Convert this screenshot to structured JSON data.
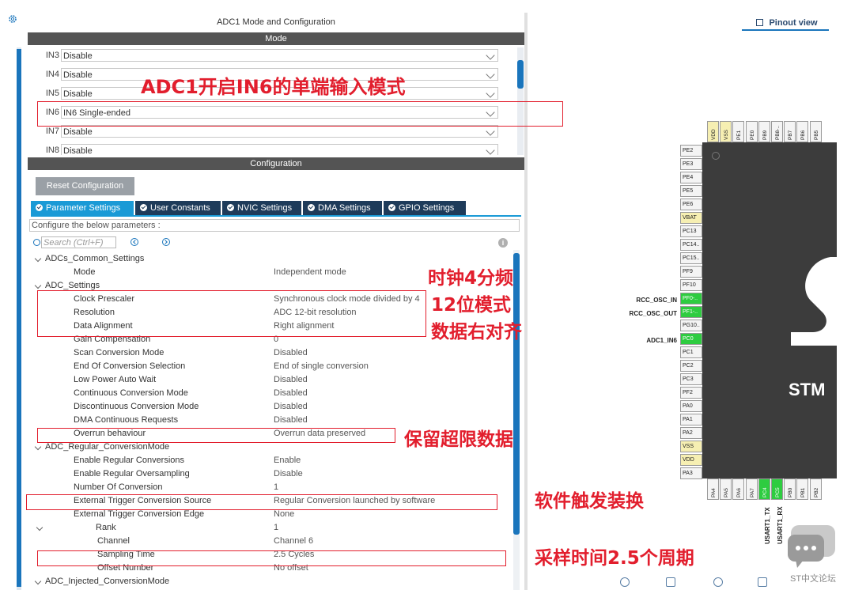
{
  "panel_title": "ADC1 Mode and Configuration",
  "mode_bar": "Mode",
  "config_bar": "Configuration",
  "inputs": [
    {
      "label": "IN3",
      "value": "Disable"
    },
    {
      "label": "IN4",
      "value": "Disable"
    },
    {
      "label": "IN5",
      "value": "Disable"
    },
    {
      "label": "IN6",
      "value": "IN6 Single-ended"
    },
    {
      "label": "IN7",
      "value": "Disable"
    },
    {
      "label": "IN8",
      "value": "Disable"
    }
  ],
  "reset_button": "Reset Configuration",
  "tabs": [
    "Parameter Settings",
    "User Constants",
    "NVIC Settings",
    "DMA Settings",
    "GPIO Settings"
  ],
  "config_desc": "Configure the below parameters :",
  "search_placeholder": "Search (Ctrl+F)",
  "info": "i",
  "params": [
    {
      "name": "ADCs_Common_Settings",
      "value": "",
      "level": 0,
      "group": true
    },
    {
      "name": "Mode",
      "value": "Independent mode",
      "level": 1
    },
    {
      "name": "ADC_Settings",
      "value": "",
      "level": 0,
      "group": true
    },
    {
      "name": "Clock Prescaler",
      "value": "Synchronous clock mode divided by 4",
      "level": 1
    },
    {
      "name": "Resolution",
      "value": "ADC 12-bit resolution",
      "level": 1
    },
    {
      "name": "Data Alignment",
      "value": "Right alignment",
      "level": 1
    },
    {
      "name": "Gain Compensation",
      "value": "0",
      "level": 1
    },
    {
      "name": "Scan Conversion Mode",
      "value": "Disabled",
      "level": 1
    },
    {
      "name": "End Of Conversion Selection",
      "value": "End of single conversion",
      "level": 1
    },
    {
      "name": "Low Power Auto Wait",
      "value": "Disabled",
      "level": 1
    },
    {
      "name": "Continuous Conversion Mode",
      "value": "Disabled",
      "level": 1
    },
    {
      "name": "Discontinuous Conversion Mode",
      "value": "Disabled",
      "level": 1
    },
    {
      "name": "DMA Continuous Requests",
      "value": "Disabled",
      "level": 1
    },
    {
      "name": "Overrun behaviour",
      "value": "Overrun data preserved",
      "level": 1
    },
    {
      "name": "ADC_Regular_ConversionMode",
      "value": "",
      "level": 0,
      "group": true
    },
    {
      "name": "Enable Regular Conversions",
      "value": "Enable",
      "level": 1
    },
    {
      "name": "Enable Regular Oversampling",
      "value": "Disable",
      "level": 1
    },
    {
      "name": "Number Of Conversion",
      "value": "1",
      "level": 1
    },
    {
      "name": "External Trigger Conversion Source",
      "value": "Regular Conversion launched by software",
      "level": 1
    },
    {
      "name": "External Trigger Conversion Edge",
      "value": "None",
      "level": 1
    },
    {
      "name": "Rank",
      "value": "1",
      "level": 2,
      "group": true
    },
    {
      "name": "Channel",
      "value": "Channel 6",
      "level": 3
    },
    {
      "name": "Sampling Time",
      "value": "2.5 Cycles",
      "level": 3
    },
    {
      "name": "Offset Number",
      "value": "No offset",
      "level": 3
    },
    {
      "name": "ADC_Injected_ConversionMode",
      "value": "",
      "level": 0,
      "group": true
    }
  ],
  "annotations": {
    "in6": "ADC1开启IN6的单端输入模式",
    "clock": "时钟4分频",
    "resolution": "12位模式",
    "alignment": "数据右对齐",
    "overrun": "保留超限数据",
    "trigger": "软件触发装换",
    "sampling": "采样时间2.5个周期"
  },
  "pinout_view": "Pinout view",
  "top_pins": [
    {
      "label": "VDD",
      "color": "yellow"
    },
    {
      "label": "VSS",
      "color": "yellow"
    },
    {
      "label": "PE1",
      "color": "gray"
    },
    {
      "label": "PE0",
      "color": "gray"
    },
    {
      "label": "PB9",
      "color": "gray"
    },
    {
      "label": "PB8-..",
      "color": "gray"
    },
    {
      "label": "PB7",
      "color": "gray"
    },
    {
      "label": "PB6",
      "color": "gray"
    },
    {
      "label": "PB5",
      "color": "gray"
    }
  ],
  "left_pins": [
    {
      "label": "PE2",
      "color": "gray"
    },
    {
      "label": "PE3",
      "color": "gray"
    },
    {
      "label": "PE4",
      "color": "gray"
    },
    {
      "label": "PE5",
      "color": "gray"
    },
    {
      "label": "PE6",
      "color": "gray"
    },
    {
      "label": "VBAT",
      "color": "yellow"
    },
    {
      "label": "PC13",
      "color": "gray"
    },
    {
      "label": "PC14..",
      "color": "gray"
    },
    {
      "label": "PC15..",
      "color": "gray"
    },
    {
      "label": "PF9",
      "color": "gray"
    },
    {
      "label": "PF10",
      "color": "gray"
    },
    {
      "label": "PF0-..",
      "color": "green"
    },
    {
      "label": "PF1-..",
      "color": "green"
    },
    {
      "label": "PG10..",
      "color": "gray"
    },
    {
      "label": "PC0",
      "color": "green"
    },
    {
      "label": "PC1",
      "color": "gray"
    },
    {
      "label": "PC2",
      "color": "gray"
    },
    {
      "label": "PC3",
      "color": "gray"
    },
    {
      "label": "PF2",
      "color": "gray"
    },
    {
      "label": "PA0",
      "color": "gray"
    },
    {
      "label": "PA1",
      "color": "gray"
    },
    {
      "label": "PA2",
      "color": "gray"
    },
    {
      "label": "VSS",
      "color": "yellow"
    },
    {
      "label": "VDD",
      "color": "yellow"
    },
    {
      "label": "PA3",
      "color": "gray"
    }
  ],
  "bottom_pins": [
    {
      "label": "PA4",
      "color": "gray"
    },
    {
      "label": "PA5",
      "color": "gray"
    },
    {
      "label": "PA6",
      "color": "gray"
    },
    {
      "label": "PA7",
      "color": "gray"
    },
    {
      "label": "PC4",
      "color": "green"
    },
    {
      "label": "PC5",
      "color": "green"
    },
    {
      "label": "PB0",
      "color": "gray"
    },
    {
      "label": "PB1",
      "color": "gray"
    },
    {
      "label": "PB2",
      "color": "gray"
    }
  ],
  "signals": {
    "rcc_in": "RCC_OSC_IN",
    "rcc_out": "RCC_OSC_OUT",
    "adc_in6": "ADC1_IN6",
    "usart_tx": "USART1_TX",
    "usart_rx": "USART1_RX"
  },
  "chip_label": "STM",
  "watermark": "ST中文论坛",
  "colors": {
    "accent": "#1a75bc",
    "annotation": "#e21e2d",
    "pin_green": "#2ecc40",
    "pin_yellow": "#f6efb2"
  }
}
